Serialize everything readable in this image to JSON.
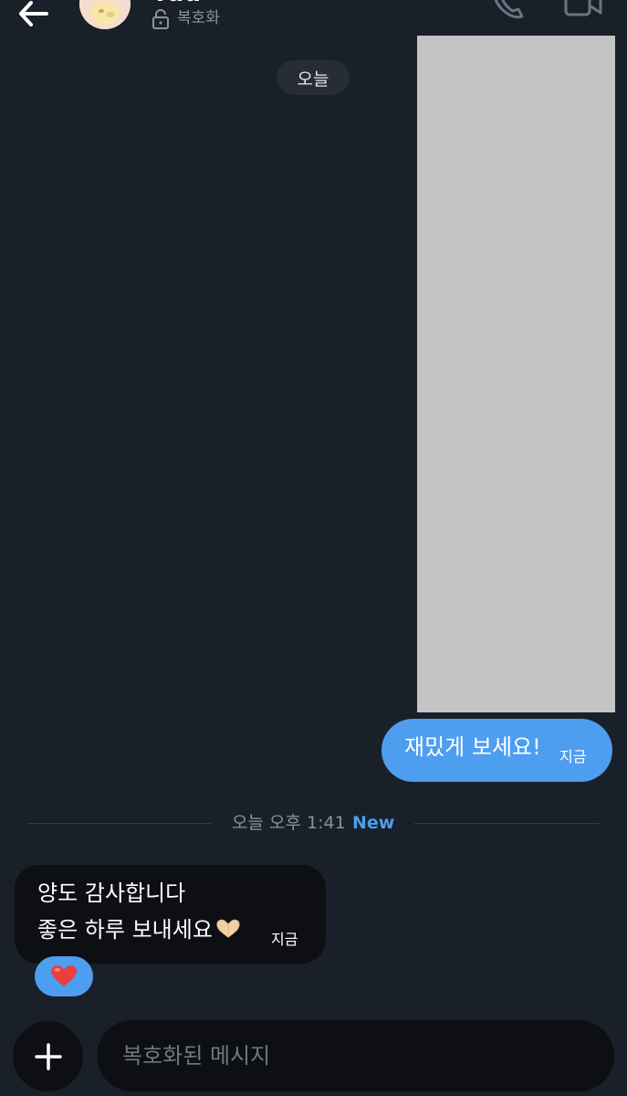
{
  "header": {
    "contact_name": "Yuu",
    "encryption_label": "복호화",
    "back_icon": "arrow-left-icon",
    "call_icon": "phone-icon",
    "video_icon": "video-camera-icon",
    "lock_icon": "unlocked-lock-icon"
  },
  "conversation": {
    "date_chip": "오늘",
    "outgoing_message": {
      "text": "재밌게 보세요!",
      "time": "지금"
    },
    "divider": {
      "label": "오늘 오후 1:41",
      "new_badge": "New"
    },
    "incoming_message": {
      "line1": "양도 감사합니다",
      "line2": "좋은 하루 보내세요",
      "line2_emoji": "hand-heart-emoji",
      "time": "지금"
    },
    "reaction": {
      "emoji": "red-heart-emoji"
    }
  },
  "composer": {
    "placeholder": "복호화된 메시지",
    "plus_icon": "plus-icon"
  },
  "colors": {
    "background": "#192029",
    "accent": "#4d9eee",
    "incoming_bubble": "#0d0f12",
    "muted_text": "#8a929c"
  }
}
